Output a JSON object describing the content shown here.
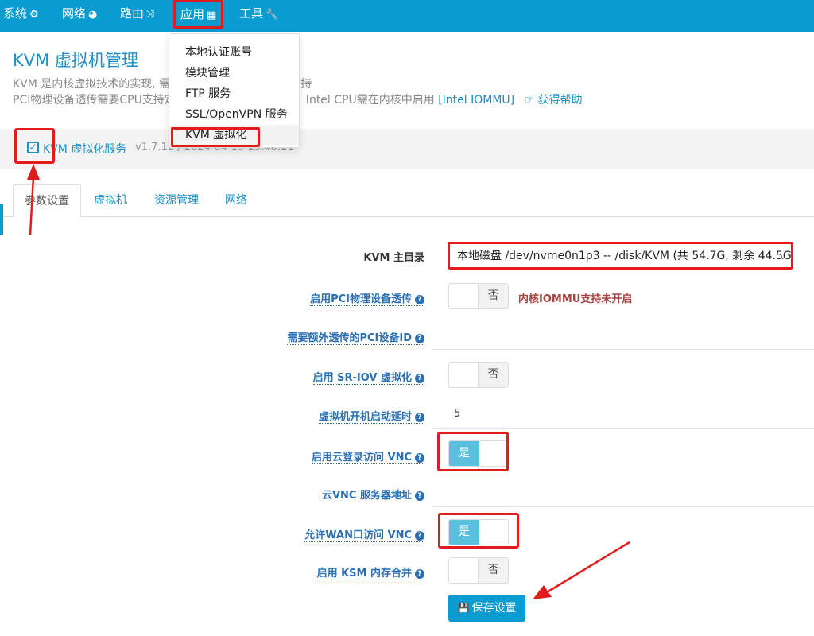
{
  "nav": {
    "system": "系统",
    "network": "网络",
    "route": "路由",
    "apps": "应用",
    "tools": "工具"
  },
  "header": {
    "title": "KVM 虚拟机管理",
    "desc_line1": "KVM 是内核虚拟技术的实现, 需要",
    "desc_line1_tail": "持",
    "desc_line2": "PCI物理设备透传需要CPU支持定",
    "desc_line2_mid": "，Intel CPU需在内核中启用",
    "desc_line2_link": "[Intel IOMMU]",
    "help_link": "获得帮助"
  },
  "apps_menu": {
    "items": [
      "本地认证账号",
      "模块管理",
      "FTP 服务",
      "SSL/OpenVPN 服务",
      "KVM 虚拟化"
    ]
  },
  "service": {
    "name": "KVM 虚拟化服务",
    "version": "v1.7.12 / 2024-04-19 15:40:21"
  },
  "tabs": [
    "参数设置",
    "虚拟机",
    "资源管理",
    "网络"
  ],
  "form": {
    "kvm_dir_label": "KVM 主目录",
    "kvm_dir_value": "本地磁盘 /dev/nvme0n1p3 -- /disk/KVM   (共 54.7G, 剩余 44.5G)",
    "pci_label": "启用PCI物理设备透传",
    "pci_value": "否",
    "pci_warning": "内核IOMMU支持未开启",
    "pci_extra_label": "需要额外透传的PCI设备ID",
    "sriov_label": "启用 SR-IOV 虚拟化",
    "sriov_value": "否",
    "boot_delay_label": "虚拟机开机启动延时",
    "boot_delay_value": "5",
    "cloud_vnc_label": "启用云登录访问 VNC",
    "cloud_vnc_value": "是",
    "cloud_vnc_server_label": "云VNC 服务器地址",
    "wan_vnc_label": "允许WAN口访问 VNC",
    "wan_vnc_value": "是",
    "ksm_label": "启用 KSM 内存合并",
    "ksm_value": "否",
    "save_label": "保存设置"
  },
  "colors": {
    "nav_bg": "#0a9bd1",
    "link": "#1a8fc7",
    "highlight_red": "#e21c1c",
    "toggle_on": "#5bc0de",
    "warning": "#a94442"
  }
}
